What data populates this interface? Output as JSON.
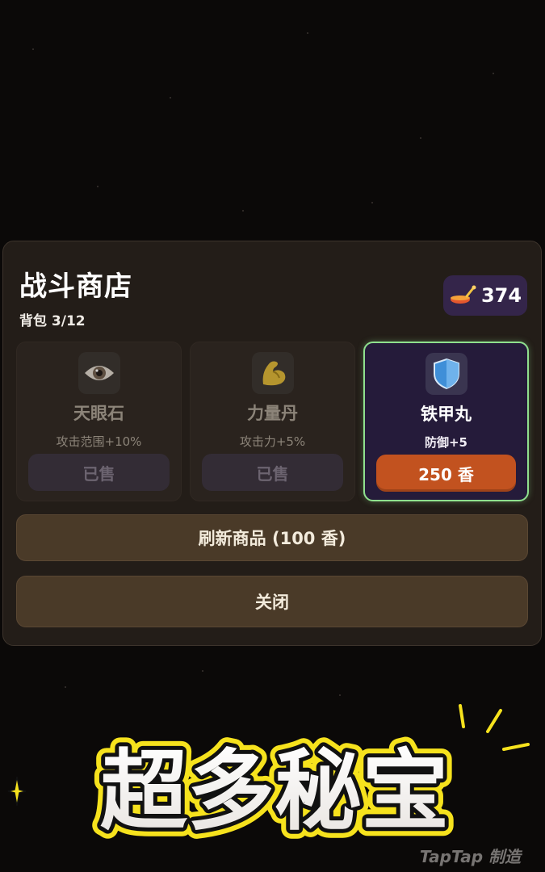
{
  "shop": {
    "title": "战斗商店",
    "bag_label": "背包 3/12",
    "currency": {
      "value": "374",
      "icon": "incense-burner-icon"
    }
  },
  "items": [
    {
      "name": "天眼石",
      "desc": "攻击范围+10%",
      "button": "已售",
      "icon": "eye-icon",
      "state": "sold"
    },
    {
      "name": "力量丹",
      "desc": "攻击力+5%",
      "button": "已售",
      "icon": "flexed-bicep-icon",
      "state": "sold"
    },
    {
      "name": "铁甲丸",
      "desc": "防御+5",
      "button": "250 香",
      "icon": "shield-icon",
      "state": "available"
    }
  ],
  "actions": {
    "refresh": "刷新商品 (100 香)",
    "close": "关闭"
  },
  "banner_text": "超多秘宝",
  "watermark": "TapTap 制造",
  "colors": {
    "panel_bg": "#231d18",
    "active_border": "#8fe08e",
    "buy_button": "#c2521f",
    "action_button": "#4a3a28",
    "currency_bg": "#34254a",
    "banner_outline": "#f6e21d"
  }
}
